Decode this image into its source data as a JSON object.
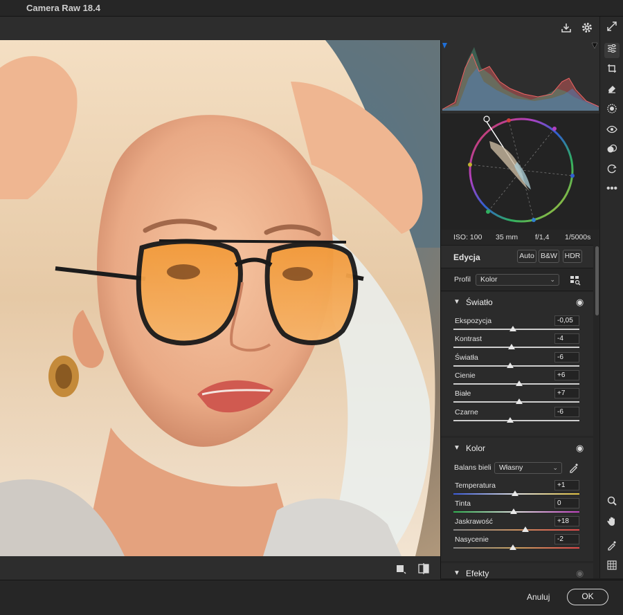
{
  "window": {
    "title": "Camera Raw 18.4"
  },
  "exif": {
    "iso": "ISO: 100",
    "focal": "35 mm",
    "aperture": "f/1,4",
    "shutter": "1/5000s"
  },
  "edit": {
    "title": "Edycja",
    "auto": "Auto",
    "bw": "B&W",
    "hdr": "HDR",
    "profile_label": "Profil",
    "profile_value": "Kolor"
  },
  "light": {
    "title": "Światło",
    "sliders": [
      {
        "label": "Ekspozycja",
        "value": "-0,05",
        "pos": 0.47
      },
      {
        "label": "Kontrast",
        "value": "-4",
        "pos": 0.46
      },
      {
        "label": "Światła",
        "value": "-6",
        "pos": 0.45
      },
      {
        "label": "Cienie",
        "value": "+6",
        "pos": 0.52
      },
      {
        "label": "Białe",
        "value": "+7",
        "pos": 0.52
      },
      {
        "label": "Czarne",
        "value": "-6",
        "pos": 0.45
      }
    ]
  },
  "color": {
    "title": "Kolor",
    "wb_label": "Balans bieli",
    "wb_value": "Własny",
    "sliders": [
      {
        "label": "Temperatura",
        "value": "+1",
        "pos": 0.49
      },
      {
        "label": "Tinta",
        "value": "0",
        "pos": 0.48
      },
      {
        "label": "Jaskrawość",
        "value": "+18",
        "pos": 0.57
      },
      {
        "label": "Nasycenie",
        "value": "-2",
        "pos": 0.47
      }
    ]
  },
  "effects": {
    "title": "Efekty"
  },
  "footer": {
    "cancel": "Anuluj",
    "ok": "OK"
  }
}
